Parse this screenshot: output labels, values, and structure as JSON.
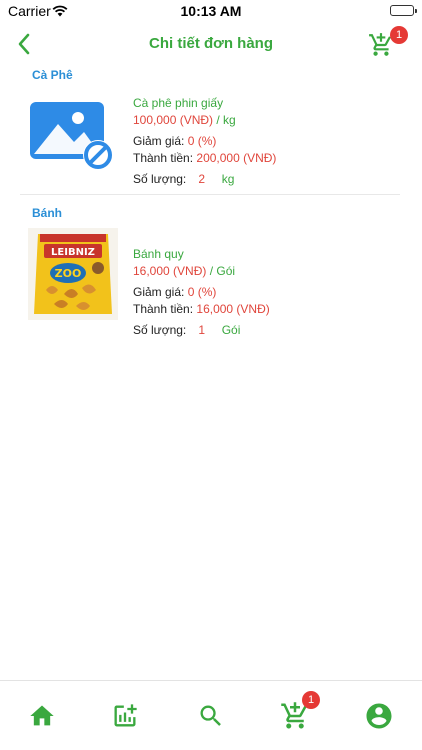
{
  "status_bar": {
    "carrier": "Carrier",
    "time": "10:13 AM"
  },
  "header": {
    "title": "Chi tiết đơn hàng",
    "cart_badge": "1"
  },
  "sections": [
    {
      "category": "Cà Phê",
      "product": {
        "name": "Cà phê phin giấy",
        "price": "100,000 (VNĐ)",
        "unit": "/ kg",
        "discount_label": "Giảm giá:",
        "discount_value": "0 (%)",
        "total_label": "Thành tiền:",
        "total_value": "200,000 (VNĐ)",
        "quantity_label": "Số lượng:",
        "quantity_value": "2",
        "quantity_unit": "kg"
      }
    },
    {
      "category": "Bánh",
      "product": {
        "name": "Bánh quy",
        "price": "16,000 (VNĐ)",
        "unit": "/ Gói",
        "discount_label": "Giảm giá:",
        "discount_value": "0 (%)",
        "total_label": "Thành tiền:",
        "total_value": "16,000 (VNĐ)",
        "quantity_label": "Số lượng:",
        "quantity_value": "1",
        "quantity_unit": "Gói",
        "package_brand": "LEIBNIZ",
        "package_name": "ZOO"
      }
    }
  ],
  "tab_bar": {
    "items": [
      "home-icon",
      "add-chart-icon",
      "search-icon",
      "cart-icon",
      "account-icon"
    ],
    "cart_badge": "1",
    "active_color": "#3aa83f"
  },
  "colors": {
    "accent_green": "#3aa83f",
    "price_red": "#e0463c",
    "category_blue": "#2b8fd6",
    "badge_red": "#e53935"
  }
}
